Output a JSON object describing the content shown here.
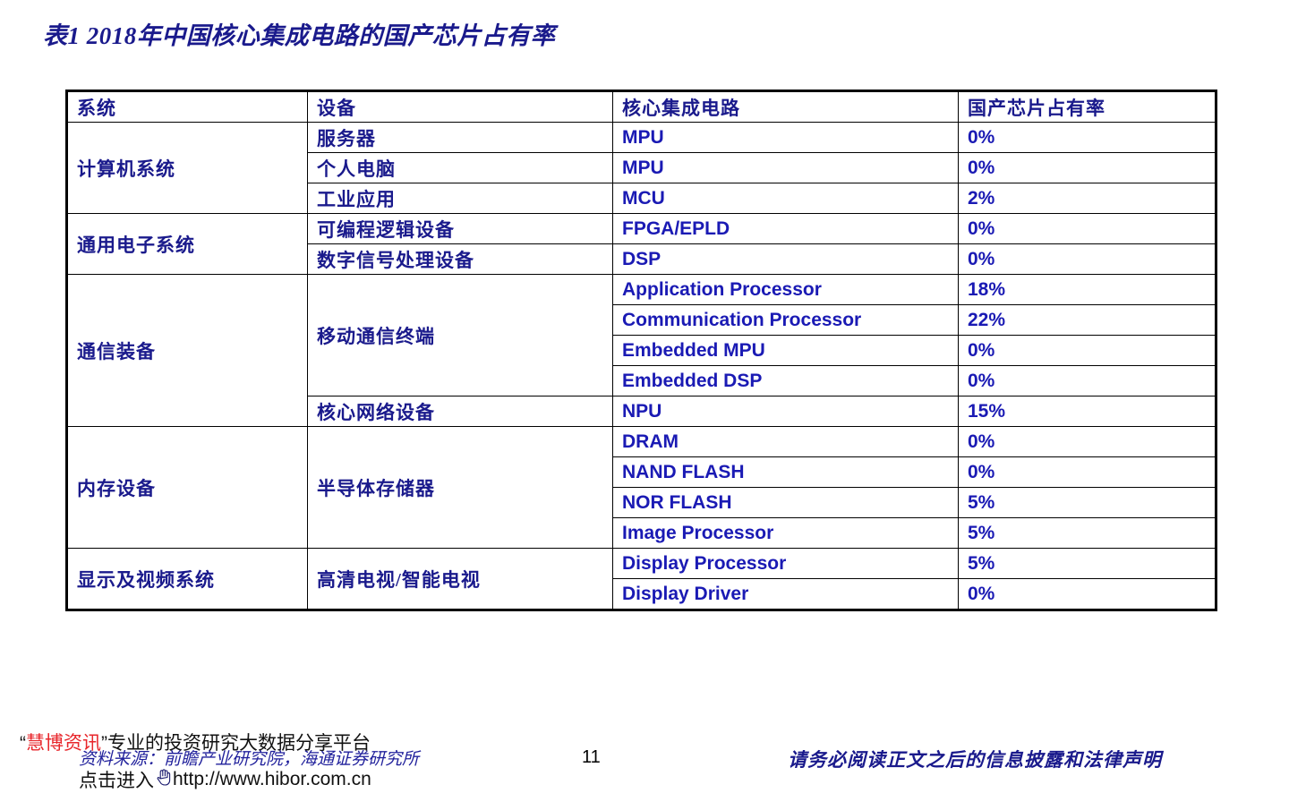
{
  "title": "表1  2018年中国核心集成电路的国产芯片占有率",
  "table": {
    "headers": {
      "system": "系统",
      "device": "设备",
      "circuit": "核心集成电路",
      "rate": "国产芯片占有率"
    },
    "rows": [
      {
        "system": "计算机系统",
        "system_rowspan": 3,
        "device": "服务器",
        "device_rowspan": 1,
        "circuit": "MPU",
        "rate": "0%",
        "group_start": true
      },
      {
        "system": "",
        "system_rowspan": 0,
        "device": "个人电脑",
        "device_rowspan": 1,
        "circuit": "MPU",
        "rate": "0%",
        "group_start": false
      },
      {
        "system": "",
        "system_rowspan": 0,
        "device": "工业应用",
        "device_rowspan": 1,
        "circuit": "MCU",
        "rate": "2%",
        "group_start": false
      },
      {
        "system": "通用电子系统",
        "system_rowspan": 2,
        "device": "可编程逻辑设备",
        "device_rowspan": 1,
        "circuit": "FPGA/EPLD",
        "rate": "0%",
        "group_start": true
      },
      {
        "system": "",
        "system_rowspan": 0,
        "device": "数字信号处理设备",
        "device_rowspan": 1,
        "circuit": "DSP",
        "rate": "0%",
        "group_start": false
      },
      {
        "system": "通信装备",
        "system_rowspan": 5,
        "device": "移动通信终端",
        "device_rowspan": 4,
        "circuit": "Application Processor",
        "rate": "18%",
        "group_start": true
      },
      {
        "system": "",
        "system_rowspan": 0,
        "device": "",
        "device_rowspan": 0,
        "circuit": "Communication Processor",
        "rate": "22%",
        "group_start": false
      },
      {
        "system": "",
        "system_rowspan": 0,
        "device": "",
        "device_rowspan": 0,
        "circuit": "Embedded MPU",
        "rate": "0%",
        "group_start": false
      },
      {
        "system": "",
        "system_rowspan": 0,
        "device": "",
        "device_rowspan": 0,
        "circuit": "Embedded DSP",
        "rate": "0%",
        "group_start": false
      },
      {
        "system": "",
        "system_rowspan": 0,
        "device": "核心网络设备",
        "device_rowspan": 1,
        "circuit": "NPU",
        "rate": "15%",
        "group_start": false
      },
      {
        "system": "内存设备",
        "system_rowspan": 4,
        "device": "半导体存储器",
        "device_rowspan": 4,
        "circuit": "DRAM",
        "rate": "0%",
        "group_start": true
      },
      {
        "system": "",
        "system_rowspan": 0,
        "device": "",
        "device_rowspan": 0,
        "circuit": "NAND FLASH",
        "rate": "0%",
        "group_start": false
      },
      {
        "system": "",
        "system_rowspan": 0,
        "device": "",
        "device_rowspan": 0,
        "circuit": "NOR FLASH",
        "rate": "5%",
        "group_start": false
      },
      {
        "system": "",
        "system_rowspan": 0,
        "device": "",
        "device_rowspan": 0,
        "circuit": "Image Processor",
        "rate": "5%",
        "group_start": false
      },
      {
        "system": "显示及视频系统",
        "system_rowspan": 2,
        "device": "高清电视/智能电视",
        "device_rowspan": 2,
        "circuit": "Display Processor",
        "rate": "5%",
        "group_start": true
      },
      {
        "system": "",
        "system_rowspan": 0,
        "device": "",
        "device_rowspan": 0,
        "circuit": "Display Driver",
        "rate": "0%",
        "group_start": false
      }
    ]
  },
  "footer": {
    "source": "资料来源：前瞻产业研究院，海通证券研究所",
    "page_number": "11",
    "disclaimer": "请务必阅读正文之后的信息披露和法律声明"
  },
  "watermark": {
    "open_quote": "“",
    "brand": "慧博资讯",
    "close_quote": "”",
    "tagline": "专业的投资研究大数据分享平台",
    "click_prefix": "点击进入",
    "cursor_icon": "hand-pointer-icon",
    "url": "http://www.hibor.com.cn"
  },
  "colors": {
    "title_blue": "#1a1a8c",
    "latin_blue": "#1a1ab4",
    "brand_red": "#e8262b",
    "border_black": "#000000"
  }
}
